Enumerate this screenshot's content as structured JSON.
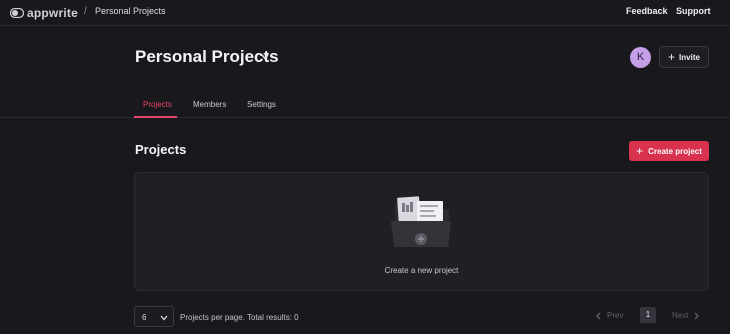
{
  "brand": {
    "name": "appwrite"
  },
  "breadcrumb": {
    "separator": "/",
    "current": "Personal Projects"
  },
  "topnav": {
    "feedback": "Feedback",
    "support": "Support"
  },
  "header": {
    "title": "Personal Projects",
    "avatar_initial": "K",
    "invite_label": "Invite"
  },
  "tabs": [
    {
      "label": "Projects",
      "active": true
    },
    {
      "label": "Members",
      "active": false
    },
    {
      "label": "Settings",
      "active": false
    }
  ],
  "section": {
    "title": "Projects",
    "create_label": "Create project",
    "empty_label": "Create a new project"
  },
  "pagination": {
    "per_page": "6",
    "results_text": "Projects per page. Total results: 0",
    "prev_label": "Prev",
    "page": "1",
    "next_label": "Next"
  },
  "colors": {
    "accent": "#e8436b",
    "button_primary": "#d8324f",
    "background": "#19191d",
    "avatar": "#c59fe8"
  }
}
